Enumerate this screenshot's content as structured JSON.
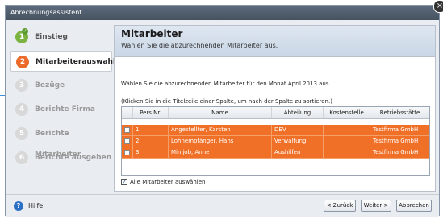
{
  "window": {
    "title": "Abrechnungsassistent",
    "close": "×"
  },
  "steps": [
    {
      "num": "1",
      "label": "Einstieg",
      "state": "done",
      "check": "✓"
    },
    {
      "num": "2",
      "label": "Mitarbeiterauswahl",
      "state": "active"
    },
    {
      "num": "3",
      "label": "Bezüge",
      "state": "todo"
    },
    {
      "num": "4",
      "label": "Berichte Firma",
      "state": "todo"
    },
    {
      "num": "5",
      "label": "Berichte Mitarbeiter",
      "state": "todo"
    },
    {
      "num": "6",
      "label": "Berichte ausgeben",
      "state": "todo"
    }
  ],
  "header": {
    "title": "Mitarbeiter",
    "subtitle": "Wählen Sie die abzurechnenden Mitarbeiter aus."
  },
  "instructions": {
    "month": "Wählen Sie die abzurechnenden Mitarbeiter für den Monat April 2013 aus.",
    "sort": "(Klicken Sie in die Titelzeile einer Spalte, um nach der Spalte zu sortieren.)"
  },
  "table": {
    "columns": [
      "",
      "Pers.Nr.",
      "Name",
      "Abteilung",
      "Kostenstelle",
      "Betriebsstätte"
    ],
    "rows": [
      {
        "nr": "1",
        "name": "Angestellter, Karsten",
        "abteilung": "DEV",
        "kostenstelle": "",
        "betrieb": "Testfirma GmbH"
      },
      {
        "nr": "2",
        "name": "Lohnempfänger, Hans",
        "abteilung": "Verwaltung",
        "kostenstelle": "",
        "betrieb": "Testfirma GmbH"
      },
      {
        "nr": "3",
        "name": "Minijob, Anne",
        "abteilung": "Aushilfen",
        "kostenstelle": "",
        "betrieb": "Testfirma GmbH"
      }
    ]
  },
  "select_all": {
    "label": "Alle Mitarbeiter auswählen",
    "checked": true,
    "mark": "✓"
  },
  "footer": {
    "help_icon": "?",
    "help_label": "Hilfe",
    "back": "< Zurück",
    "next": "Weiter >",
    "cancel": "Abbrechen"
  },
  "colors": {
    "accent": "#f07028",
    "done": "#7cb342",
    "callout": "#3a8fd6"
  }
}
